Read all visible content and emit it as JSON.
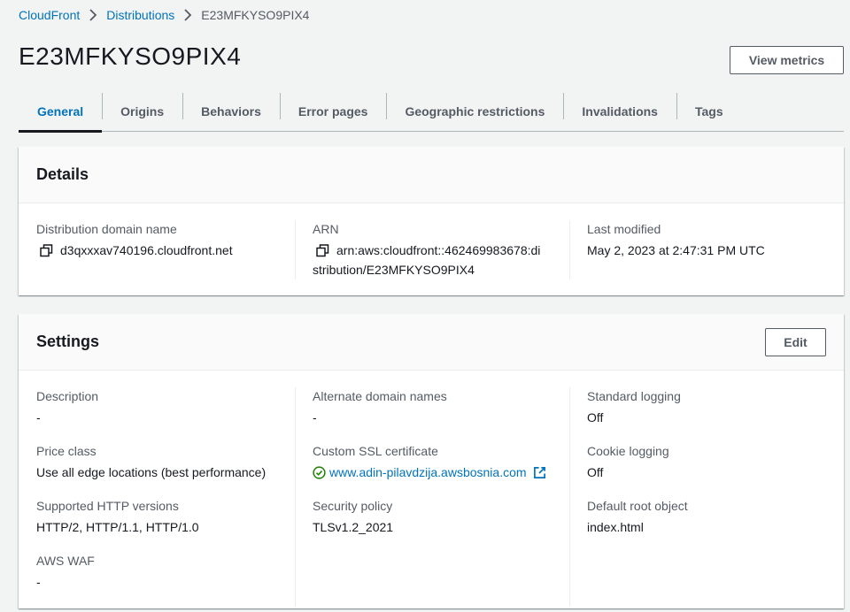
{
  "breadcrumb": {
    "root": "CloudFront",
    "section": "Distributions",
    "current": "E23MFKYSO9PIX4"
  },
  "page_title": "E23MFKYSO9PIX4",
  "header": {
    "view_metrics_label": "View metrics"
  },
  "tabs": [
    {
      "label": "General",
      "active": true
    },
    {
      "label": "Origins"
    },
    {
      "label": "Behaviors"
    },
    {
      "label": "Error pages"
    },
    {
      "label": "Geographic restrictions"
    },
    {
      "label": "Invalidations"
    },
    {
      "label": "Tags"
    }
  ],
  "details": {
    "title": "Details",
    "domain_label": "Distribution domain name",
    "domain_value": "d3qxxxav740196.cloudfront.net",
    "arn_label": "ARN",
    "arn_line1": "arn:aws:cloudfront::462469983678:di",
    "arn_line2": "stribution/E23MFKYSO9PIX4",
    "modified_label": "Last modified",
    "modified_value": "May 2, 2023 at 2:47:31 PM UTC"
  },
  "settings": {
    "title": "Settings",
    "edit_label": "Edit",
    "description_label": "Description",
    "description_value": "-",
    "price_class_label": "Price class",
    "price_class_value": "Use all edge locations (best performance)",
    "http_versions_label": "Supported HTTP versions",
    "http_versions_value": "HTTP/2, HTTP/1.1, HTTP/1.0",
    "waf_label": "AWS WAF",
    "waf_value": "-",
    "alt_domains_label": "Alternate domain names",
    "alt_domains_value": "-",
    "ssl_label": "Custom SSL certificate",
    "ssl_value": "www.adin-pilavdzija.awsbosnia.com",
    "security_policy_label": "Security policy",
    "security_policy_value": "TLSv1.2_2021",
    "std_logging_label": "Standard logging",
    "std_logging_value": "Off",
    "cookie_logging_label": "Cookie logging",
    "cookie_logging_value": "Off",
    "root_object_label": "Default root object",
    "root_object_value": "index.html"
  },
  "colors": {
    "link": "#0073bb",
    "success": "#1d8102",
    "text": "#16191f",
    "muted": "#545b64"
  }
}
